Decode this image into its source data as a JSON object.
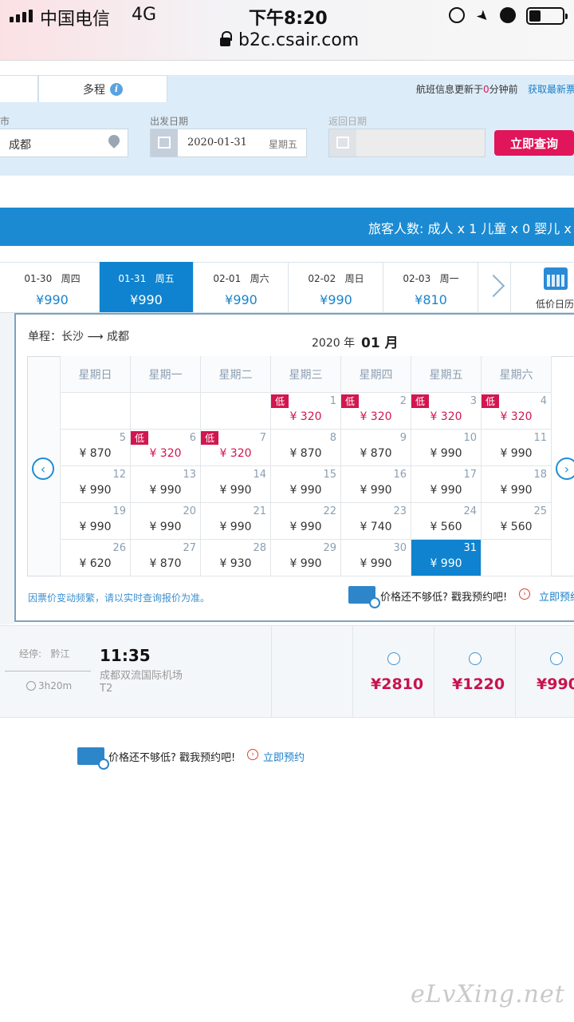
{
  "status_bar": {
    "carrier": "中国电信",
    "network": "4G",
    "time": "下午8:20",
    "url": "b2c.csair.com"
  },
  "search": {
    "tab_multi": "多程",
    "update_note": "航班信息更新于",
    "update_minutes": "0",
    "update_suffix": "分钟前",
    "refresh_link": "获取最新票",
    "city_label": "市",
    "city_value": "成都",
    "depart_label": "出发日期",
    "depart_date": "2020-01-31",
    "depart_weekday": "星期五",
    "return_label": "返回日期",
    "query_button": "立即查询"
  },
  "passengers": "旅客人数: 成人 x 1 儿童 x 0 婴儿 x",
  "date_strip": [
    {
      "date": "01-30",
      "weekday": "周四",
      "price": "¥990"
    },
    {
      "date": "01-31",
      "weekday": "周五",
      "price": "¥990",
      "selected": true
    },
    {
      "date": "02-01",
      "weekday": "周六",
      "price": "¥990"
    },
    {
      "date": "02-02",
      "weekday": "周日",
      "price": "¥990"
    },
    {
      "date": "02-03",
      "weekday": "周一",
      "price": "¥810"
    }
  ],
  "low_calendar_label": "低价日历",
  "calendar": {
    "route": "单程：长沙 ⟶ 成都",
    "year": "2020 年",
    "month": "01 月",
    "weekdays": [
      "星期日",
      "星期一",
      "星期二",
      "星期三",
      "星期四",
      "星期五",
      "星期六"
    ],
    "low_tag": "低",
    "weeks": [
      [
        null,
        null,
        null,
        {
          "day": "1",
          "price": "¥ 320",
          "low": true
        },
        {
          "day": "2",
          "price": "¥ 320",
          "low": true
        },
        {
          "day": "3",
          "price": "¥ 320",
          "low": true
        },
        {
          "day": "4",
          "price": "¥ 320",
          "low": true
        }
      ],
      [
        {
          "day": "5",
          "price": "¥ 870"
        },
        {
          "day": "6",
          "price": "¥ 320",
          "low": true
        },
        {
          "day": "7",
          "price": "¥ 320",
          "low": true
        },
        {
          "day": "8",
          "price": "¥ 870"
        },
        {
          "day": "9",
          "price": "¥ 870"
        },
        {
          "day": "10",
          "price": "¥ 990"
        },
        {
          "day": "11",
          "price": "¥ 990"
        }
      ],
      [
        {
          "day": "12",
          "price": "¥ 990"
        },
        {
          "day": "13",
          "price": "¥ 990"
        },
        {
          "day": "14",
          "price": "¥ 990"
        },
        {
          "day": "15",
          "price": "¥ 990"
        },
        {
          "day": "16",
          "price": "¥ 990"
        },
        {
          "day": "17",
          "price": "¥ 990"
        },
        {
          "day": "18",
          "price": "¥ 990"
        }
      ],
      [
        {
          "day": "19",
          "price": "¥ 990"
        },
        {
          "day": "20",
          "price": "¥ 990"
        },
        {
          "day": "21",
          "price": "¥ 990"
        },
        {
          "day": "22",
          "price": "¥ 990"
        },
        {
          "day": "23",
          "price": "¥ 740"
        },
        {
          "day": "24",
          "price": "¥ 560"
        },
        {
          "day": "25",
          "price": "¥ 560"
        }
      ],
      [
        {
          "day": "26",
          "price": "¥ 620"
        },
        {
          "day": "27",
          "price": "¥ 870"
        },
        {
          "day": "28",
          "price": "¥ 930"
        },
        {
          "day": "29",
          "price": "¥ 990"
        },
        {
          "day": "30",
          "price": "¥ 990"
        },
        {
          "day": "31",
          "price": "¥ 990",
          "selected": true
        },
        null
      ]
    ],
    "notice": "因票价变动频繁，请以实时查询报价为准。",
    "promo_text": "价格还不够低? 戳我预约吧!",
    "promo_link": "立即预约"
  },
  "flight": {
    "stop_label": "经停:",
    "stop_city": "黔江",
    "duration": "3h20m",
    "arrive_time": "11:35",
    "arrive_airport": "成都双流国际机场",
    "terminal": "T2",
    "prices": [
      "¥2810",
      "¥1220",
      "¥990"
    ]
  },
  "promo2": {
    "text": "价格还不够低? 戳我预约吧!",
    "link": "立即预约"
  },
  "watermark": "eLvXing.net"
}
